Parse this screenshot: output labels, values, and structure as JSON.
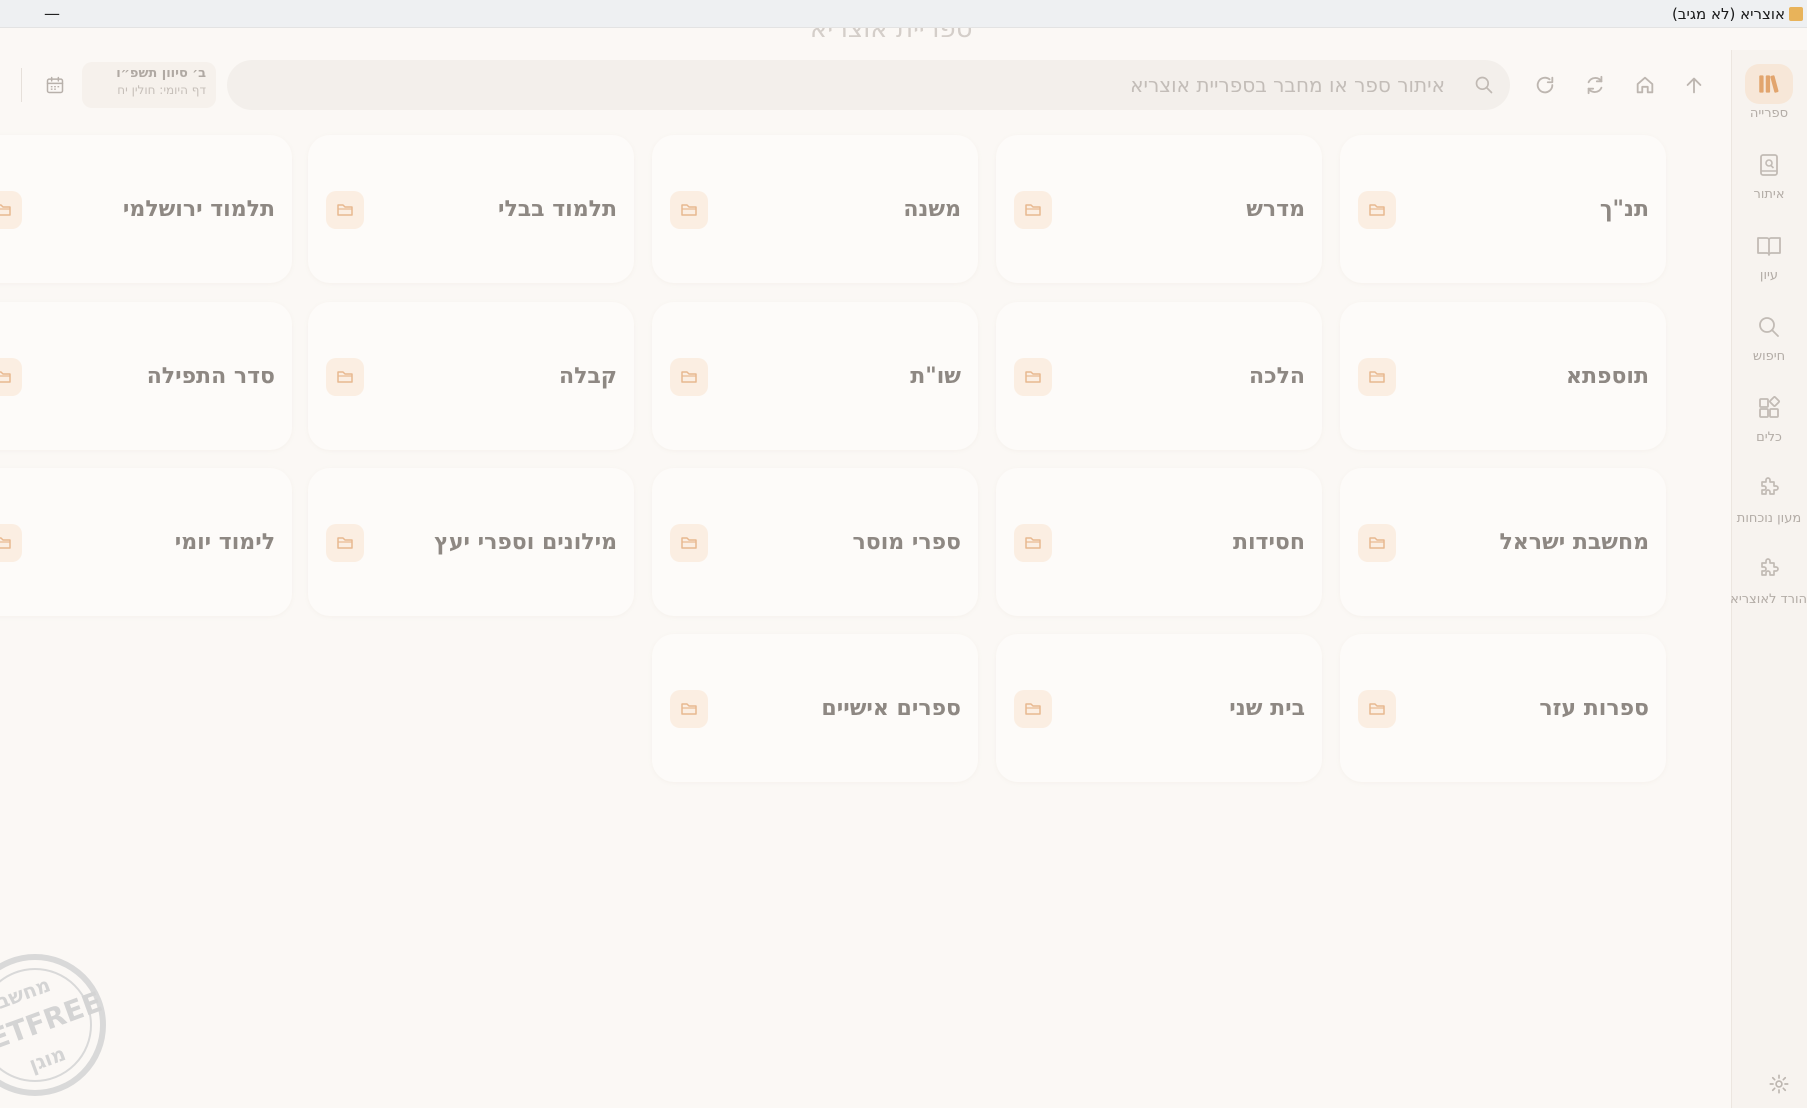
{
  "window": {
    "title": "אוצריא (לא מגיב)",
    "ghost_heading": "ספריית אוצריא",
    "minimize_glyph": "—"
  },
  "rail": {
    "items": [
      {
        "label": "ספרייה",
        "icon": "library-icon"
      },
      {
        "label": "איתור",
        "icon": "find-book-icon"
      },
      {
        "label": "עיון",
        "icon": "book-open-icon"
      },
      {
        "label": "חיפוש",
        "icon": "search-icon"
      },
      {
        "label": "כלים",
        "icon": "tools-icon"
      },
      {
        "label": "מעון נוכחות",
        "icon": "puzzle-icon"
      },
      {
        "label": "הורד לאוצריא",
        "icon": "puzzle-icon"
      }
    ],
    "settings_icon": "gear-icon"
  },
  "topbar": {
    "search_placeholder": "איתור ספר או מחבר בספריית אוצריא",
    "search_value": "",
    "hebrew_date": "ב׳ סיוון תשפ״ו",
    "daf_yomi": "דף היומי: חולין יח"
  },
  "categories": [
    "תנ\"ך",
    "מדרש",
    "משנה",
    "תלמוד בבלי",
    "תלמוד ירושלמי",
    "תוספתא",
    "הלכה",
    "שו\"ת",
    "קבלה",
    "סדר התפילה",
    "מחשבת ישראל",
    "חסידות",
    "ספרי מוסר",
    "מילונים וספרי יעץ",
    "לימוד יומי",
    "ספרות עזר",
    "בית שני",
    "ספרים אישיים"
  ],
  "watermark": {
    "lines": [
      "מחשב",
      "NETFREE",
      "מוגן"
    ]
  },
  "colors": {
    "background": "#fbf8f5",
    "card": "#fdfbf9",
    "accent": "#e8a56a",
    "folder_bg": "#fbeee2",
    "text": "#8e8883"
  }
}
